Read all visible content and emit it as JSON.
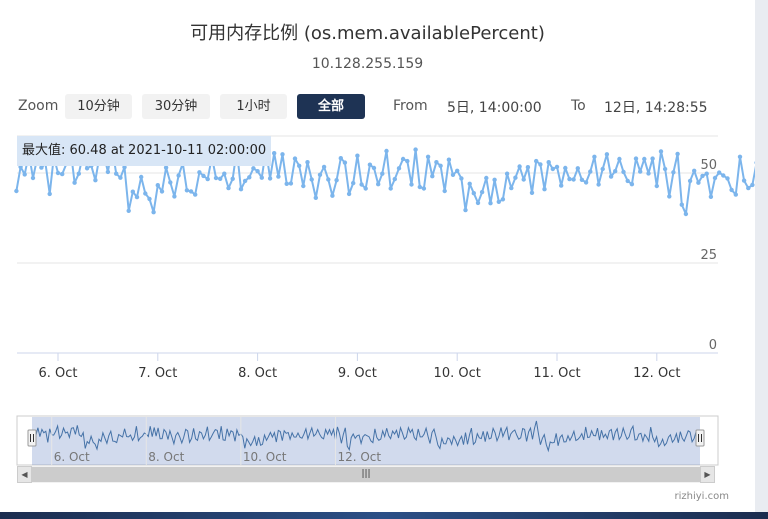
{
  "colors": {
    "series": "#7cb5ec",
    "navigator_series": "#4572a7",
    "active_button": "#1e3354"
  },
  "range_selector": {
    "zoom_label": "Zoom",
    "buttons": [
      {
        "label": "10分钟",
        "active": false
      },
      {
        "label": "30分钟",
        "active": false
      },
      {
        "label": "1小时",
        "active": false
      },
      {
        "label": "全部",
        "active": true
      }
    ],
    "from_label": "From",
    "from_value": "5日, 14:00:00",
    "to_label": "To",
    "to_value": "12日, 14:28:55"
  },
  "tooltip": {
    "text": "最大值: 60.48 at 2021-10-11 02:00:00"
  },
  "scrollbar": {
    "grip_icon": "grip-icon"
  },
  "credits": "rizhiyi.com",
  "chart_data": {
    "type": "line",
    "title": "可用内存比例 (os.mem.availablePercent)",
    "subtitle": "10.128.255.159",
    "x_tick_labels": [
      "6. Oct",
      "7. Oct",
      "8. Oct",
      "9. Oct",
      "10. Oct",
      "11. Oct",
      "12. Oct"
    ],
    "x_range": [
      "2021-10-05 14:00",
      "2021-10-12 14:29"
    ],
    "y_ticks": [
      0,
      25,
      50
    ],
    "ylim": [
      0,
      60
    ],
    "navigator_x_tick_labels": [
      "6. Oct",
      "8. Oct",
      "10. Oct",
      "12. Oct"
    ],
    "series": [
      {
        "x_start": "2021-10-05 14:00",
        "interval_hours": 1,
        "values": [
          45.0,
          51.7,
          49.6,
          55.4,
          48.6,
          54.1,
          51.5,
          52.6,
          44.2,
          54.5,
          50.0,
          49.7,
          52.5,
          56.7,
          47.3,
          49.8,
          55.1,
          51.3,
          52.0,
          48.0,
          54.9,
          55.4,
          50.3,
          57.2,
          49.8,
          48.7,
          51.6,
          39.5,
          44.8,
          43.3,
          48.9,
          44.3,
          42.8,
          39.1,
          46.6,
          44.9,
          51.5,
          47.4,
          43.5,
          49.3,
          52.7,
          45.2,
          44.9,
          44.0,
          50.2,
          49.2,
          48.3,
          54.5,
          48.6,
          48.4,
          49.8,
          45.8,
          48.4,
          56.5,
          45.5,
          47.8,
          48.8,
          51.3,
          50.5,
          48.7,
          56.5,
          48.5,
          55.5,
          49.0,
          55.2,
          47.0,
          47.1,
          54.0,
          52.0,
          46.4,
          53.0,
          48.2,
          43.1,
          49.5,
          51.7,
          48.2,
          43.7,
          48.0,
          54.1,
          52.9,
          44.2,
          47.2,
          54.8,
          46.8,
          45.7,
          52.3,
          51.4,
          46.9,
          49.8,
          56.1,
          45.7,
          48.3,
          51.3,
          53.9,
          53.3,
          46.8,
          56.5,
          46.1,
          45.7,
          54.5,
          49.1,
          53.0,
          52.0,
          45.0,
          53.7,
          49.5,
          50.6,
          48.5,
          39.7,
          47.0,
          44.4,
          41.7,
          44.7,
          48.6,
          41.6,
          48.1,
          42.0,
          42.7,
          49.8,
          45.8,
          48.7,
          51.8,
          48.2,
          51.6,
          44.5,
          53.3,
          52.4,
          45.5,
          53.0,
          51.1,
          51.7,
          46.5,
          51.4,
          48.3,
          48.2,
          51.3,
          48.1,
          47.4,
          50.4,
          54.5,
          46.8,
          51.1,
          55.2,
          49.0,
          50.5,
          53.9,
          50.3,
          47.8,
          46.9,
          54.0,
          50.4,
          53.9,
          49.9,
          54.0,
          46.4,
          56.0,
          51.1,
          43.5,
          50.2,
          55.3,
          41.2,
          38.6,
          47.8,
          50.6,
          47.3,
          49.2,
          49.8,
          43.4,
          48.6,
          50.1,
          49.3,
          48.5,
          45.3,
          44.0,
          54.5,
          47.9,
          45.8,
          46.7,
          52.9,
          48.7,
          55.0,
          49.3,
          47.0,
          52.8,
          50.6,
          53.4,
          47.5,
          55.4,
          51.2,
          46.6,
          48.3,
          55.4,
          51.7,
          54.1,
          47.8,
          46.0,
          54.4,
          48.4,
          48.4,
          50.5,
          55.0,
          48.6,
          43.3,
          51.7,
          54.2,
          48.4,
          42.1,
          39.5,
          47.3,
          43.2,
          43.0,
          47.6,
          46.7,
          42.7,
          48.8,
          45.6,
          41.8,
          46.1,
          48.8,
          42.4,
          51.6,
          42.7,
          49.9,
          55.1,
          42.7,
          44.4,
          50.9,
          47.7,
          47.1,
          52.6,
          44.8,
          52.5,
          46.8,
          47.5,
          54.8,
          51.5,
          45.4,
          49.1,
          55.5,
          48.7,
          52.4,
          55.7,
          45.9,
          50.6,
          52.5,
          53.6,
          49.8,
          46.6,
          47.7,
          54.7,
          54.1,
          44.9,
          52.2,
          55.1,
          46.5,
          54.8,
          60.5,
          51.0,
          42.4,
          47.3,
          50.1,
          42.5,
          38.0,
          44.5,
          43.8,
          44.1,
          51.0,
          41.6,
          48.0,
          49.9,
          44.5,
          44.6,
          49.3,
          45.7,
          48.7,
          52.6,
          45.6,
          46.4,
          48.1,
          50.9,
          46.1,
          55.9,
          47.9,
          48.2,
          53.1,
          49.4,
          49.2,
          55.1,
          45.9,
          53.5,
          48.0,
          50.4,
          47.1,
          52.9,
          54.0,
          45.9,
          52.0,
          54.6,
          46.4,
          48.9,
          55.1,
          50.6,
          46.5,
          48.4,
          53.8,
          56.5,
          46.0,
          46.3,
          50.5,
          51.1,
          45.2,
          50.2,
          48.0,
          45.1,
          55.8,
          48.1,
          44.6,
          48.5,
          41.0,
          43.0,
          46.6,
          41.7,
          43.6,
          48.2,
          50.0,
          44.3,
          46.4,
          50.8,
          43.9,
          52.3,
          47.2,
          45.1,
          49.0,
          53.0,
          52.0,
          44.6,
          47.1,
          52.4,
          50.8,
          48.1
        ],
        "pixel_note": "hourly samples read off the plotted line"
      }
    ]
  }
}
